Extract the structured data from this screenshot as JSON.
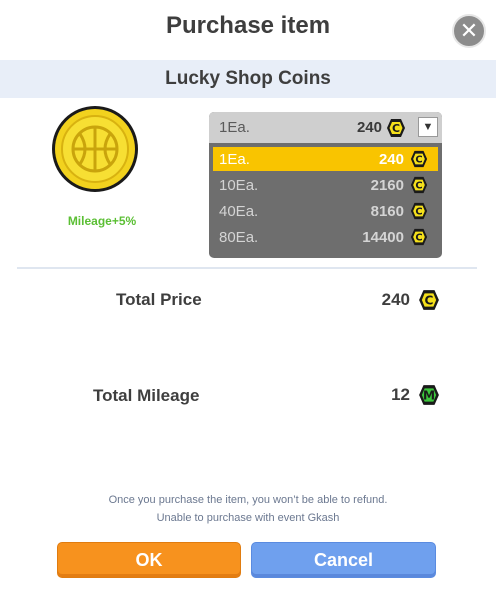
{
  "dialog": {
    "title": "Purchase item",
    "subtitle": "Lucky Shop Coins",
    "close_icon": "close-icon"
  },
  "item": {
    "icon": "basketball-coin-icon",
    "mileage_bonus": "Mileage+5%"
  },
  "quantity_select": {
    "selected": {
      "qty": "1Ea.",
      "price": "240"
    },
    "options": [
      {
        "qty": "1Ea.",
        "price": "240",
        "selected": true
      },
      {
        "qty": "10Ea.",
        "price": "2160",
        "selected": false
      },
      {
        "qty": "40Ea.",
        "price": "8160",
        "selected": false
      },
      {
        "qty": "80Ea.",
        "price": "14400",
        "selected": false
      }
    ],
    "currency_icon": "coin-c-icon"
  },
  "summary": {
    "total_price_label": "Total Price",
    "total_price_value": "240",
    "total_mileage_label": "Total Mileage",
    "total_mileage_value": "12",
    "mileage_icon": "mileage-m-icon"
  },
  "notes": {
    "line1": "Once you purchase the item, you won’t be able to refund.",
    "line2": "Unable to purchase with event Gkash"
  },
  "buttons": {
    "ok": "OK",
    "cancel": "Cancel"
  },
  "colors": {
    "accent_yellow": "#f9c400",
    "ok_orange": "#f7921e",
    "cancel_blue": "#6fa0ee",
    "mileage_green": "#5bbf34",
    "subtitle_band": "#e8eef8"
  }
}
